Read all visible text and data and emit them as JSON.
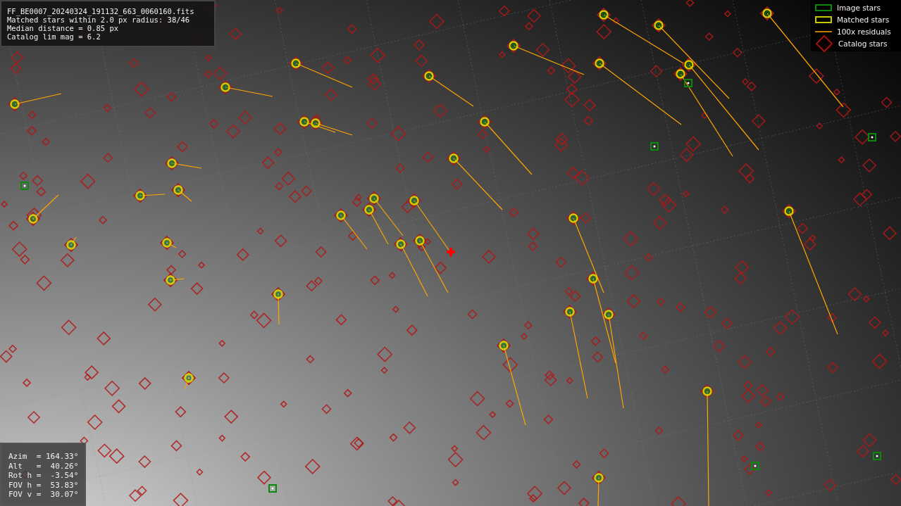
{
  "info_panel": {
    "lines": [
      "FF_BE0007_20240324_191132_663_0060160.fits",
      "Matched stars within 2.0 px radius: 38/46",
      "Median distance = 0.85 px",
      "Catalog lim mag = 6.2"
    ]
  },
  "legend": [
    {
      "kind": "image",
      "label": "Image stars"
    },
    {
      "kind": "matched",
      "label": "Matched stars"
    },
    {
      "kind": "residual",
      "label": "100x residuals"
    },
    {
      "kind": "catalog",
      "label": "Catalog stars"
    }
  ],
  "pointing_panel": {
    "lines": [
      "Azim  = 164.33°",
      "Alt   =  40.26°",
      "Rot h =  -3.54°",
      "FOV h =  53.83°",
      "FOV v =  30.07°"
    ]
  }
}
